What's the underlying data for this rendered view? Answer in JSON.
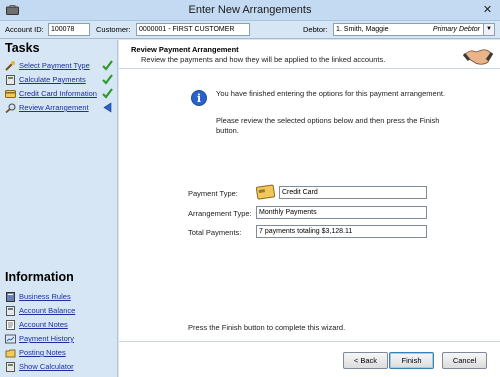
{
  "window": {
    "title": "Enter New Arrangements",
    "icon": "app-icon",
    "close_label": "✕"
  },
  "infobar": {
    "account_label": "Account ID:",
    "account_value": "100078",
    "customer_label": "Customer:",
    "customer_value": "0000001 - FIRST CUSTOMER",
    "debtor_label": "Debtor:",
    "debtor_value": "1. Smith, Maggie",
    "debtor_role": "Primary Debtor",
    "dropdown_glyph": "▼"
  },
  "tasks": {
    "title": "Tasks",
    "items": [
      {
        "label": "Select Payment Type",
        "icon": "wand-icon",
        "status": "check-icon"
      },
      {
        "label": "Calculate Payments",
        "icon": "calculator-icon",
        "status": "check-icon"
      },
      {
        "label": "Credit Card Information",
        "icon": "credit-card-icon",
        "status": "check-icon"
      },
      {
        "label": "Review Arrangement",
        "icon": "magnifier-icon",
        "status": "current-arrow-icon"
      }
    ]
  },
  "information": {
    "title": "Information",
    "items": [
      {
        "label": "Business Rules",
        "icon": "book-icon"
      },
      {
        "label": "Account Balance",
        "icon": "balance-icon"
      },
      {
        "label": "Account Notes",
        "icon": "notes-icon"
      },
      {
        "label": "Payment History",
        "icon": "history-icon"
      },
      {
        "label": "Posting Notes",
        "icon": "posting-notes-icon"
      },
      {
        "label": "Show Calculator",
        "icon": "calculator-icon"
      }
    ]
  },
  "header": {
    "title": "Review Payment Arrangement",
    "subtitle": "Review the payments and how they will be applied to the linked accounts.",
    "icon": "handshake-icon"
  },
  "message": {
    "line1": "You have finished entering the options for this payment arrangement.",
    "line2": "Please review the selected options below and then press the Finish button."
  },
  "review": {
    "payment_type_label": "Payment Type:",
    "payment_type_value": "Credit Card",
    "arrangement_type_label": "Arrangement Type:",
    "arrangement_type_value": "Monthly Payments",
    "total_payments_label": "Total Payments:",
    "total_payments_value": "7 payments totaling $3,128.11"
  },
  "footer": {
    "finish_message": "Press the Finish button to complete this wizard.",
    "back_label": "< Back",
    "finish_label": "Finish",
    "cancel_label": "Cancel"
  },
  "colors": {
    "panel_bg": "#d7e6f4",
    "link": "#1a2fa0",
    "check": "#2e9a2e",
    "info_blue": "#2a63c7"
  }
}
